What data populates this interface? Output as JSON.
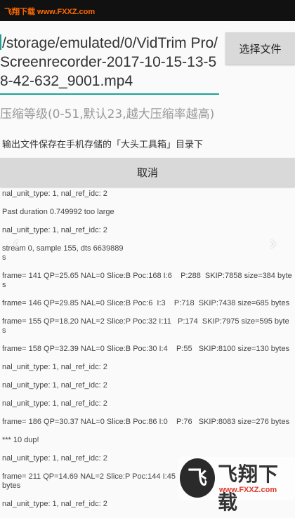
{
  "status_bar": {
    "watermark": "飞翔下载 www.FXXZ.com"
  },
  "file_path": {
    "value": "/storage/emulated/0/VidTrim Pro/Screenrecorder-2017-10-15-13-58-42-632_9001.mp4"
  },
  "select_file_button": {
    "label": "选择文件"
  },
  "compression_level": {
    "placeholder": "压缩等级(0-51,默认23,越大压缩率越高)"
  },
  "output_note": "输出文件保存在手机存储的「大头工具箱」目录下",
  "cancel_button": {
    "label": "取消"
  },
  "log_lines": [
    "nal_unit_type: 1, nal_ref_idc: 2",
    "Past duration 0.749992 too large",
    "nal_unit_type: 1, nal_ref_idc: 2",
    "stream 0, sample 155, dts 6639889\ns",
    "frame= 141 QP=25.65 NAL=0 Slice:B Poc:168 I:6    P:288  SKIP:7858 size=384 bytes",
    "frame= 146 QP=29.85 NAL=0 Slice:B Poc:6  I:3    P:718  SKIP:7438 size=685 bytes",
    "frame= 155 QP=18.20 NAL=2 Slice:P Poc:32 I:11   P:174  SKIP:7975 size=595 bytes",
    "frame= 158 QP=32.39 NAL=0 Slice:B Poc:30 I:4    P:55   SKIP:8100 size=130 bytes",
    "nal_unit_type: 1, nal_ref_idc: 2",
    "nal_unit_type: 1, nal_ref_idc: 2",
    "nal_unit_type: 1, nal_ref_idc: 2",
    "frame= 186 QP=30.37 NAL=0 Slice:B Poc:86 I:0    P:76   SKIP:8083 size=276 bytes",
    "*** 10 dup!",
    "nal_unit_type: 1, nal_ref_idc: 2",
    "frame= 211 QP=14.69 NAL=2 Slice:P Poc:144 I:45\nbytes",
    "nal_unit_type: 1, nal_ref_idc: 2"
  ],
  "watermark_logo": {
    "badge": "飞",
    "name": "飞翔下载",
    "url": "www.FXXZ.com"
  },
  "icons": {
    "left": "chevron-left-icon",
    "right": "chevron-right-icon"
  },
  "colors": {
    "accent": "#1aa394",
    "button_bg": "#d9d9d9",
    "background": "#fafafa"
  }
}
